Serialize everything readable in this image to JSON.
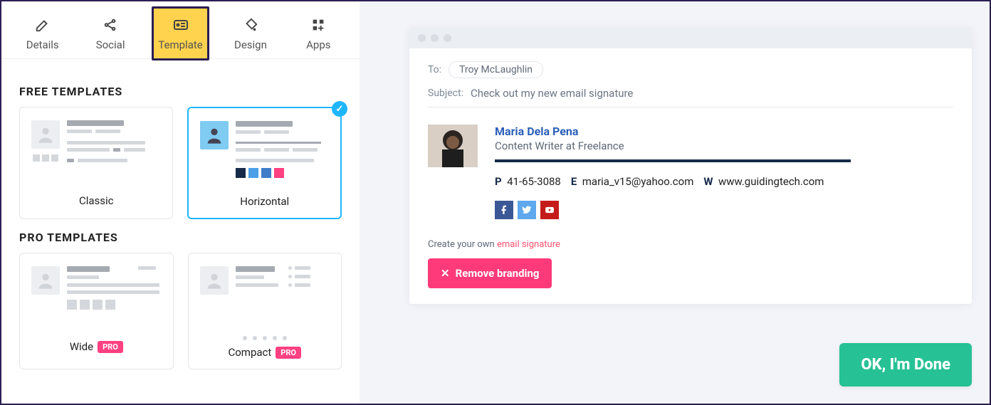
{
  "tabs": {
    "details": "Details",
    "social": "Social",
    "template": "Template",
    "design": "Design",
    "apps": "Apps"
  },
  "sections": {
    "free": "FREE TEMPLATES",
    "pro": "PRO TEMPLATES"
  },
  "templates": {
    "classic": "Classic",
    "horizontal": "Horizontal",
    "wide": "Wide",
    "compact": "Compact",
    "pro_badge": "PRO"
  },
  "mail": {
    "to_label": "To:",
    "to_value": "Troy McLaughlin",
    "subject_label": "Subject:",
    "subject_value": "Check out my new email signature"
  },
  "signature": {
    "name": "Maria Dela Pena",
    "title": "Content Writer at Freelance",
    "contacts": {
      "phone_label": "P",
      "phone": "41-65-3088",
      "email_label": "E",
      "email": "maria_v15@yahoo.com",
      "web_label": "W",
      "web": "www.guidingtech.com"
    }
  },
  "branding": {
    "prefix": "Create your own ",
    "link": "email signature",
    "remove": "Remove branding"
  },
  "done": "OK, I'm Done"
}
